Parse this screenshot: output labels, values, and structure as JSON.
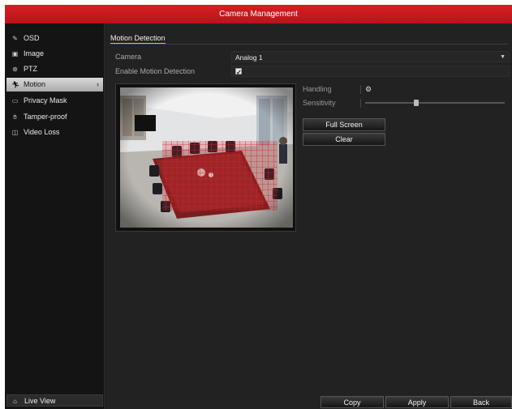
{
  "window": {
    "title": "Camera Management"
  },
  "sidebar": {
    "items": [
      {
        "label": "OSD",
        "icon": "osd-icon"
      },
      {
        "label": "Image",
        "icon": "image-icon"
      },
      {
        "label": "PTZ",
        "icon": "ptz-icon"
      },
      {
        "label": "Motion",
        "icon": "motion-icon",
        "active": true
      },
      {
        "label": "Privacy Mask",
        "icon": "privacy-mask-icon"
      },
      {
        "label": "Tamper-proof",
        "icon": "tamper-proof-icon"
      },
      {
        "label": "Video Loss",
        "icon": "video-loss-icon"
      }
    ],
    "live_view": {
      "label": "Live View",
      "icon": "home-icon"
    }
  },
  "main": {
    "tab": "Motion Detection",
    "camera": {
      "label": "Camera",
      "value": "Analog 1"
    },
    "enable_motion": {
      "label": "Enable Motion Detection",
      "checked": true
    },
    "handling": {
      "label": "Handling",
      "icon": "gear-icon"
    },
    "sensitivity": {
      "label": "Sensitivity",
      "level": 0.36
    },
    "buttons": {
      "full_screen": "Full Screen",
      "clear": "Clear"
    }
  },
  "footer": {
    "copy": "Copy",
    "apply": "Apply",
    "back": "Back"
  },
  "colors": {
    "title_bar": "#c8181d",
    "tab_underline": "#e8c21c",
    "motion_grid": "#d0262c"
  }
}
